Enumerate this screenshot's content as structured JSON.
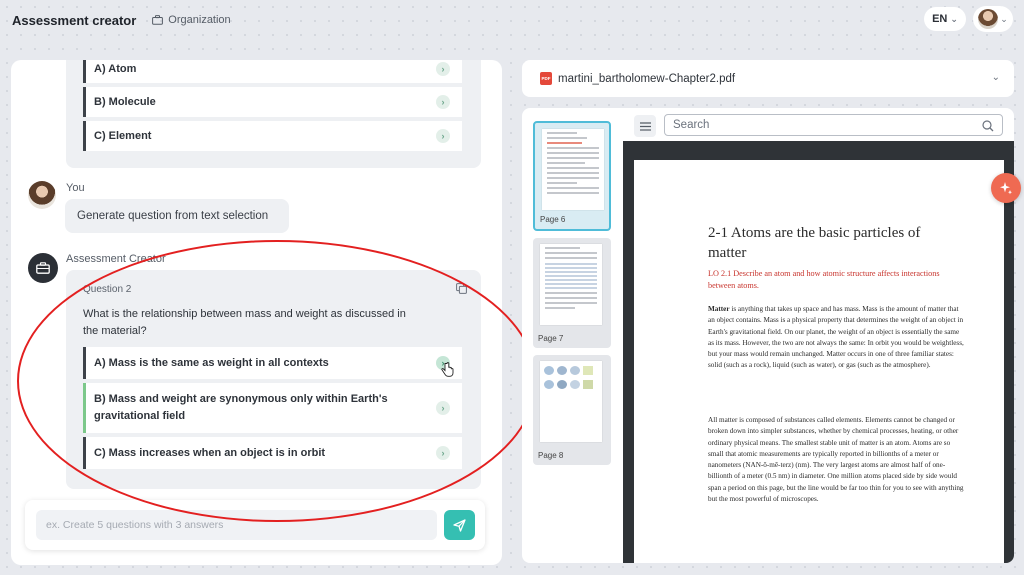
{
  "header": {
    "app_title": "Assessment creator",
    "org_label": "Organization",
    "language": "EN"
  },
  "chat": {
    "previous_answers": [
      {
        "label": "A) Atom"
      },
      {
        "label": "B) Molecule"
      },
      {
        "label": "C) Element"
      }
    ],
    "user_sender": "You",
    "user_message": "Generate question from text selection",
    "bot_sender": "Assessment Creator",
    "question": {
      "number_label": "Question 2",
      "text": "What is the relationship between mass and weight as discussed in the material?",
      "answers": [
        {
          "label": "A) Mass is the same as weight in all contexts"
        },
        {
          "label": "B) Mass and weight are synonymous only within Earth's gravitational field"
        },
        {
          "label": "C) Mass increases when an object is in orbit"
        }
      ]
    },
    "composer_placeholder": "ex. Create 5 questions with 3 answers"
  },
  "pdf": {
    "filename": "martini_bartholomew-Chapter2.pdf",
    "badge": "PDF",
    "search_placeholder": "Search",
    "thumbnails": [
      {
        "label": "Page 6",
        "active": true
      },
      {
        "label": "Page 7",
        "active": false
      },
      {
        "label": "Page 8",
        "active": false
      }
    ],
    "page": {
      "title": "2-1 Atoms are the basic particles of matter",
      "learning_objective": "LO 2.1 Describe an atom and how atomic structure affects interactions between atoms.",
      "paragraph1_lead": "Matter",
      "paragraph1_rest": " is anything that takes up space and has mass. Mass is the amount of matter that an object contains. Mass is a physical property that determines the weight of an object in Earth's gravitational field. On our planet, the weight of an object is essentially the same as its mass. However, the two are not always the same: In orbit you would be weightless, but your mass would remain unchanged. Matter occurs in one of three familiar states: solid (such as a rock), liquid (such as water), or gas (such as the atmosphere).",
      "paragraph2": "All matter is composed of substances called elements. Elements cannot be changed or broken down into simpler substances, whether by chemical processes, heating, or other ordinary physical means. The smallest stable unit of matter is an atom. Atoms are so small that atomic measurements are typically reported in billionths of a meter or nanometers (NAN-ō-mē-terz) (nm). The very largest atoms are almost half of one-billionth of a meter (0.5 nm) in diameter. One million atoms placed side by side would span a period on this page, but the line would be far too thin for you to see with anything but the most powerful of microscopes."
    }
  },
  "colors": {
    "accent": "#35bfb2",
    "annotation": "#e32020",
    "pdf_badge": "#e4483a",
    "ai_button": "#ef6a52"
  }
}
